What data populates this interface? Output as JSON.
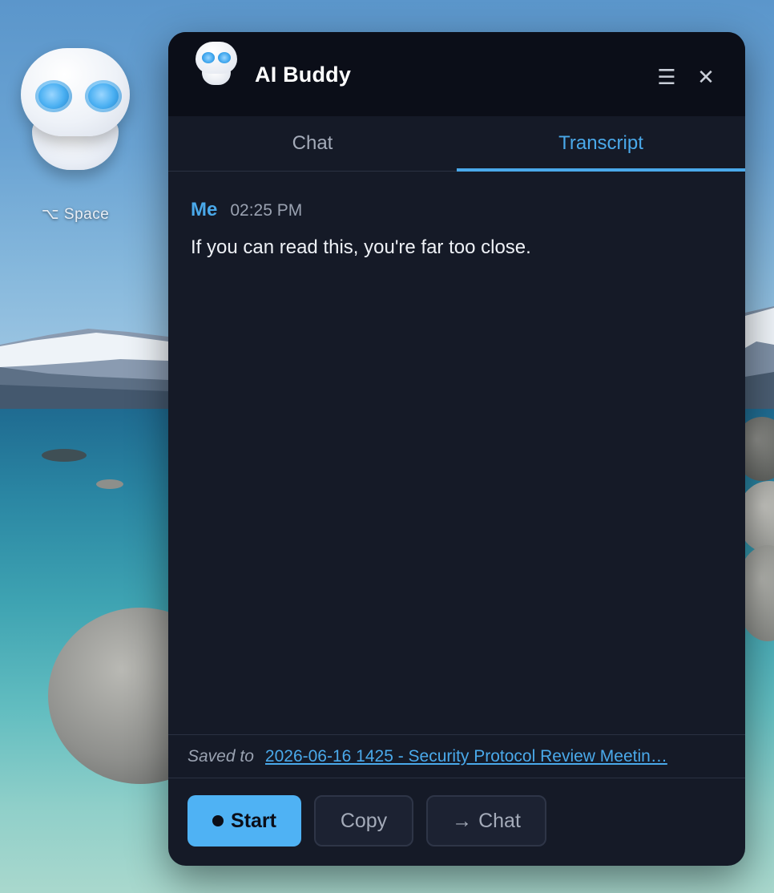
{
  "desktop": {
    "widget_shortcut": "⌥ Space"
  },
  "window": {
    "title": "AI Buddy",
    "menu_icon": "☰",
    "close_icon": "✕"
  },
  "tabs": [
    {
      "label": "Chat",
      "active": false
    },
    {
      "label": "Transcript",
      "active": true
    }
  ],
  "transcript": {
    "entries": [
      {
        "speaker": "Me",
        "time": "02:25 PM",
        "text": "If you can read this, you're far too close."
      }
    ]
  },
  "saved": {
    "label": "Saved to",
    "file_name": "2026-06-16 1425 - Security Protocol Review Meetin…"
  },
  "actions": {
    "start_label": "Start",
    "copy_label": "Copy",
    "to_chat_arrow": "→",
    "to_chat_label": "Chat"
  },
  "colors": {
    "accent": "#4aa9ea",
    "window_bg": "#151a27",
    "titlebar_bg": "#0b0e18",
    "start_button": "#4fb2f4"
  }
}
